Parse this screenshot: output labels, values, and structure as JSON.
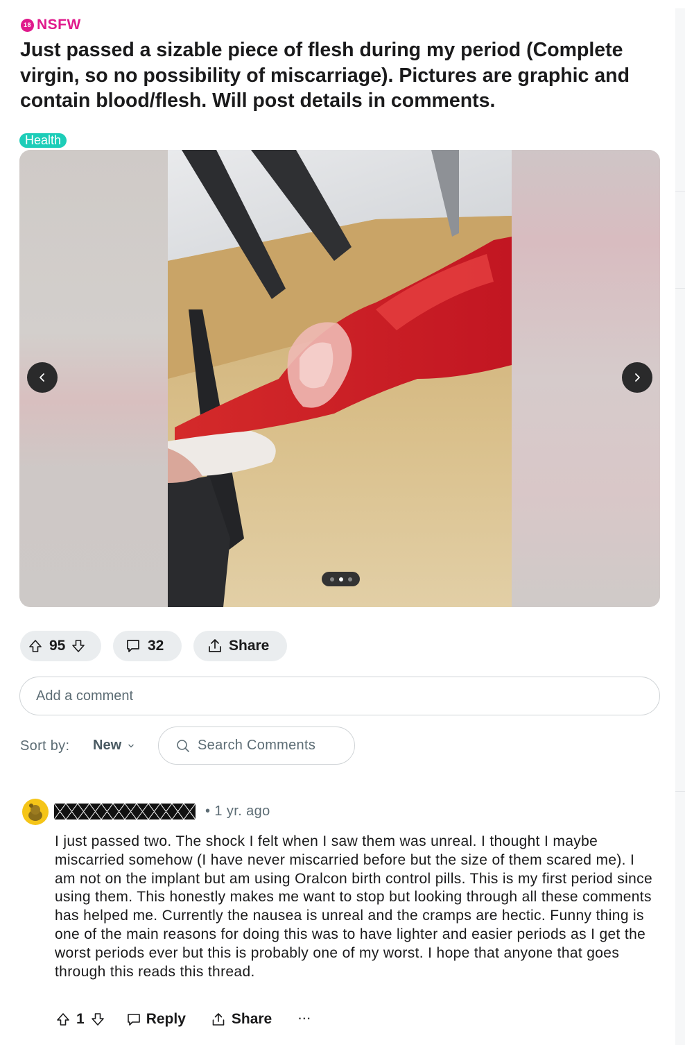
{
  "post": {
    "nsfw_label": "NSFW",
    "nsfw_badge": "18",
    "title": "Just passed a sizable piece of flesh during my period (Complete virgin, so no possibility of miscarriage). Pictures are graphic and contain blood/flesh. Will post details in comments.",
    "flair": "Health",
    "gallery": {
      "total_images": 3,
      "current_index": 2
    },
    "votes": "95",
    "comments_count": "32",
    "share_label": "Share"
  },
  "comment_box": {
    "placeholder": "Add a comment"
  },
  "sort": {
    "label": "Sort by:",
    "value": "New",
    "search_placeholder": "Search Comments"
  },
  "comment": {
    "timestamp": "• 1 yr. ago",
    "body": "I just passed two. The shock I felt when I saw them was unreal. I thought I maybe miscarried somehow (I have never miscarried before but the size of them scared me). I am not on the implant but am using Oralcon birth control pills. This is my first period since using them. This honestly makes me want to stop but looking through all these comments has helped me. Currently the nausea is unreal and the cramps are hectic. Funny thing is one of the main reasons for doing this was to have lighter and easier periods as I get the worst periods ever but this is probably one of my worst. I hope that anyone that goes through this reads this thread.",
    "votes": "1",
    "reply_label": "Reply",
    "share_label": "Share",
    "more_label": "···"
  },
  "colors": {
    "nsfw": "#e01a8c",
    "flair": "#1dcdb8",
    "pill_bg": "#eaedef",
    "muted_text": "#5c6c74"
  }
}
